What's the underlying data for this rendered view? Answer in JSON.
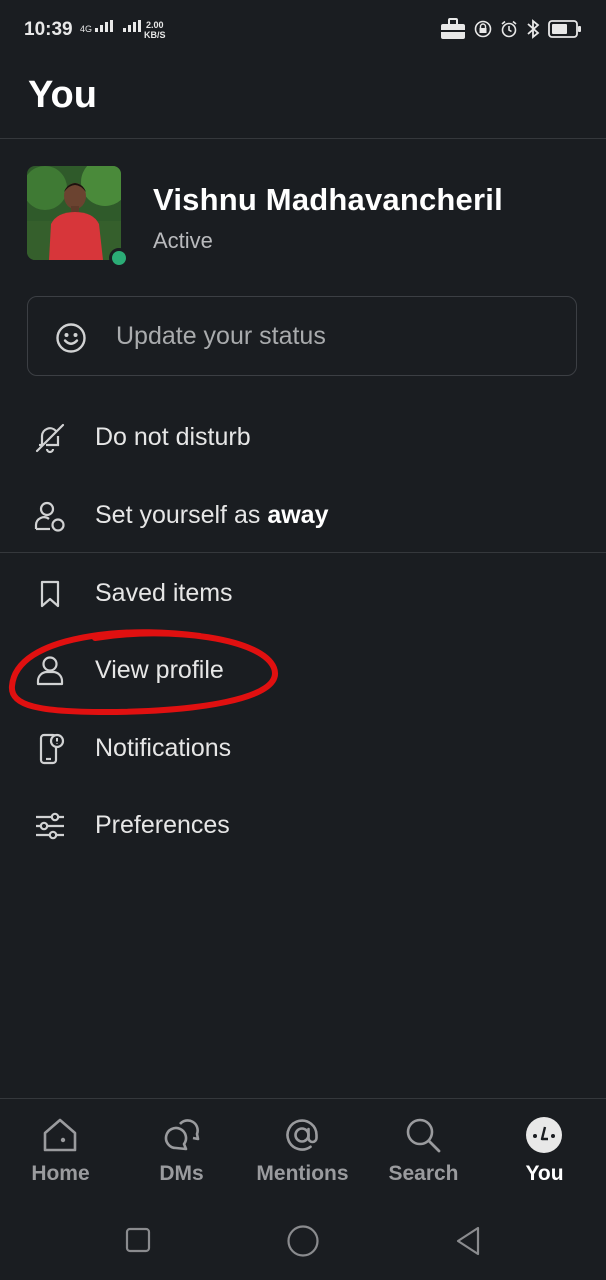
{
  "status_bar": {
    "time": "10:39",
    "network": "4G",
    "speed_value": "2.00",
    "speed_unit": "KB/S"
  },
  "header": {
    "title": "You"
  },
  "profile": {
    "name": "Vishnu Madhavancheril",
    "status": "Active"
  },
  "status_input": {
    "placeholder": "Update your status"
  },
  "menu": {
    "dnd": "Do not disturb",
    "away_prefix": "Set yourself as ",
    "away_bold": "away",
    "saved": "Saved items",
    "view_profile": "View profile",
    "notifications": "Notifications",
    "preferences": "Preferences"
  },
  "tabs": {
    "home": "Home",
    "dms": "DMs",
    "mentions": "Mentions",
    "search": "Search",
    "you": "You"
  },
  "colors": {
    "background": "#1a1d21",
    "presence": "#2bac76",
    "annotation": "#e01010"
  }
}
